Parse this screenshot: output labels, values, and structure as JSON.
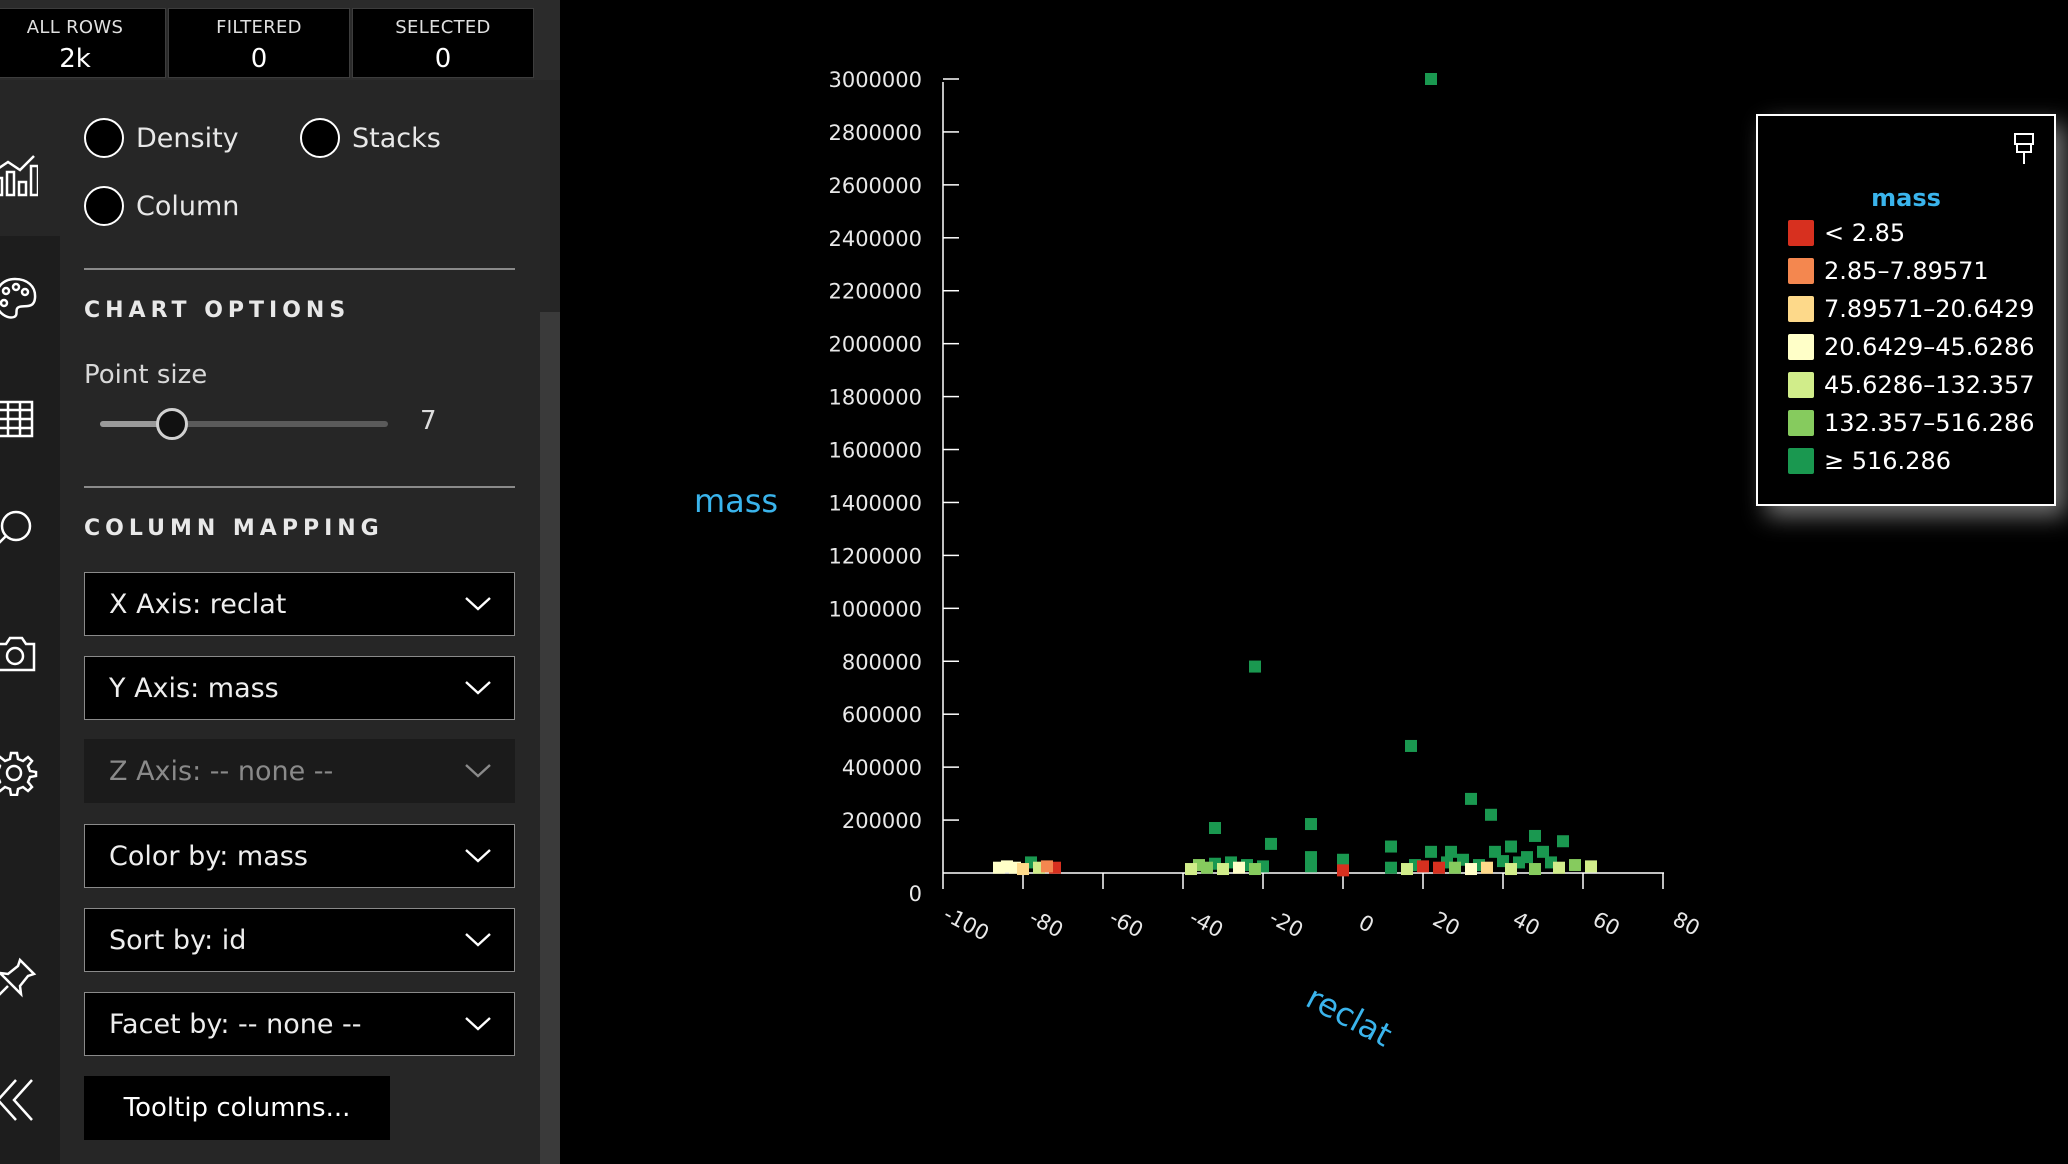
{
  "stats": [
    {
      "label": "ALL ROWS",
      "value": "2k"
    },
    {
      "label": "FILTERED",
      "value": "0"
    },
    {
      "label": "SELECTED",
      "value": "0"
    }
  ],
  "rail_icons": [
    "chart-types-icon",
    "palette-icon",
    "table-icon",
    "search-icon",
    "camera-icon",
    "gear-icon",
    "pin-icon",
    "collapse-icon"
  ],
  "chart_types": [
    "Density",
    "Stacks",
    "Column"
  ],
  "chart_options": {
    "title": "CHART OPTIONS",
    "point_size_label": "Point size",
    "point_size": 7,
    "point_size_fraction": 0.25
  },
  "column_mapping": {
    "title": "COLUMN MAPPING",
    "x_axis": "X Axis: reclat",
    "y_axis": "Y Axis: mass",
    "z_axis": "Z Axis: -- none --",
    "color_by": "Color by: mass",
    "sort_by": "Sort by: id",
    "facet_by": "Facet by: -- none --",
    "tooltip_button": "Tooltip columns..."
  },
  "legend": {
    "title": "mass",
    "items": [
      {
        "label": "< 2.85",
        "color": "#d7301f"
      },
      {
        "label": "2.85–7.89571",
        "color": "#f4874f"
      },
      {
        "label": "7.89571–20.6429",
        "color": "#fdd98a"
      },
      {
        "label": "20.6429–45.6286",
        "color": "#ffffc8"
      },
      {
        "label": "45.6286–132.357",
        "color": "#d1ed8a"
      },
      {
        "label": "132.357–516.286",
        "color": "#86cb5e"
      },
      {
        "label": "≥ 516.286",
        "color": "#1a9850"
      }
    ]
  },
  "chart_data": {
    "type": "scatter",
    "xlabel": "reclat",
    "ylabel": "mass",
    "xlim": [
      -100,
      80
    ],
    "ylim": [
      0,
      3000000
    ],
    "x_ticks": [
      "-100",
      "-80",
      "-60",
      "-40",
      "-20",
      "0",
      "20",
      "40",
      "60",
      "80"
    ],
    "y_ticks": [
      "0",
      "200000",
      "400000",
      "600000",
      "800000",
      "1000000",
      "1200000",
      "1400000",
      "1600000",
      "1800000",
      "2000000",
      "2200000",
      "2400000",
      "2600000",
      "2800000",
      "3000000"
    ],
    "grid": false,
    "legend": "top-right",
    "points": [
      {
        "x": 22.0,
        "y": 3000000,
        "c": 6
      },
      {
        "x": -22.0,
        "y": 780000,
        "c": 6
      },
      {
        "x": 17.0,
        "y": 480000,
        "c": 6
      },
      {
        "x": 32.0,
        "y": 280000,
        "c": 6
      },
      {
        "x": 37.0,
        "y": 220000,
        "c": 6
      },
      {
        "x": -32.0,
        "y": 170000,
        "c": 6
      },
      {
        "x": -8.0,
        "y": 185000,
        "c": 6
      },
      {
        "x": -18.0,
        "y": 110000,
        "c": 6
      },
      {
        "x": 48.0,
        "y": 140000,
        "c": 6
      },
      {
        "x": 55.0,
        "y": 120000,
        "c": 6
      },
      {
        "x": 12.0,
        "y": 100000,
        "c": 6
      },
      {
        "x": 42.0,
        "y": 100000,
        "c": 6
      },
      {
        "x": 22.0,
        "y": 80000,
        "c": 6
      },
      {
        "x": 27.0,
        "y": 80000,
        "c": 6
      },
      {
        "x": 38.0,
        "y": 80000,
        "c": 6
      },
      {
        "x": 46.0,
        "y": 60000,
        "c": 6
      },
      {
        "x": 50.0,
        "y": 80000,
        "c": 6
      },
      {
        "x": 0.0,
        "y": 50000,
        "c": 6
      },
      {
        "x": -8.0,
        "y": 60000,
        "c": 6
      },
      {
        "x": -78.0,
        "y": 40000,
        "c": 6
      },
      {
        "x": -36.0,
        "y": 30000,
        "c": 5
      },
      {
        "x": -32.0,
        "y": 35000,
        "c": 6
      },
      {
        "x": -28.0,
        "y": 40000,
        "c": 6
      },
      {
        "x": -24.0,
        "y": 30000,
        "c": 6
      },
      {
        "x": -20.0,
        "y": 25000,
        "c": 6
      },
      {
        "x": -8.0,
        "y": 25000,
        "c": 6
      },
      {
        "x": 0.0,
        "y": 20000,
        "c": 6
      },
      {
        "x": 12.0,
        "y": 20000,
        "c": 6
      },
      {
        "x": 18.0,
        "y": 30000,
        "c": 6
      },
      {
        "x": 26.0,
        "y": 40000,
        "c": 6
      },
      {
        "x": 30.0,
        "y": 50000,
        "c": 6
      },
      {
        "x": 34.0,
        "y": 30000,
        "c": 6
      },
      {
        "x": 40.0,
        "y": 45000,
        "c": 6
      },
      {
        "x": 44.0,
        "y": 40000,
        "c": 6
      },
      {
        "x": 52.0,
        "y": 40000,
        "c": 6
      },
      {
        "x": 58.0,
        "y": 30000,
        "c": 5
      },
      {
        "x": 62.0,
        "y": 25000,
        "c": 4
      },
      {
        "x": 20.0,
        "y": 25000,
        "c": 0
      },
      {
        "x": 24.0,
        "y": 20000,
        "c": 0
      },
      {
        "x": 0.0,
        "y": 10000,
        "c": 0
      },
      {
        "x": -72.0,
        "y": 20000,
        "c": 0
      },
      {
        "x": -82.0,
        "y": 20000,
        "c": 3
      },
      {
        "x": -86.0,
        "y": 20000,
        "c": 3
      },
      {
        "x": -76.0,
        "y": 20000,
        "c": 4
      },
      {
        "x": -80.0,
        "y": 15000,
        "c": 2
      },
      {
        "x": -84.0,
        "y": 25000,
        "c": 3
      },
      {
        "x": -74.0,
        "y": 25000,
        "c": 1
      },
      {
        "x": -38.0,
        "y": 15000,
        "c": 4
      },
      {
        "x": -34.0,
        "y": 20000,
        "c": 5
      },
      {
        "x": -30.0,
        "y": 15000,
        "c": 4
      },
      {
        "x": -26.0,
        "y": 20000,
        "c": 3
      },
      {
        "x": -22.0,
        "y": 15000,
        "c": 5
      },
      {
        "x": 16.0,
        "y": 15000,
        "c": 4
      },
      {
        "x": 28.0,
        "y": 20000,
        "c": 5
      },
      {
        "x": 32.0,
        "y": 15000,
        "c": 3
      },
      {
        "x": 36.0,
        "y": 20000,
        "c": 2
      },
      {
        "x": 42.0,
        "y": 15000,
        "c": 4
      },
      {
        "x": 48.0,
        "y": 15000,
        "c": 5
      },
      {
        "x": 54.0,
        "y": 20000,
        "c": 4
      }
    ]
  }
}
